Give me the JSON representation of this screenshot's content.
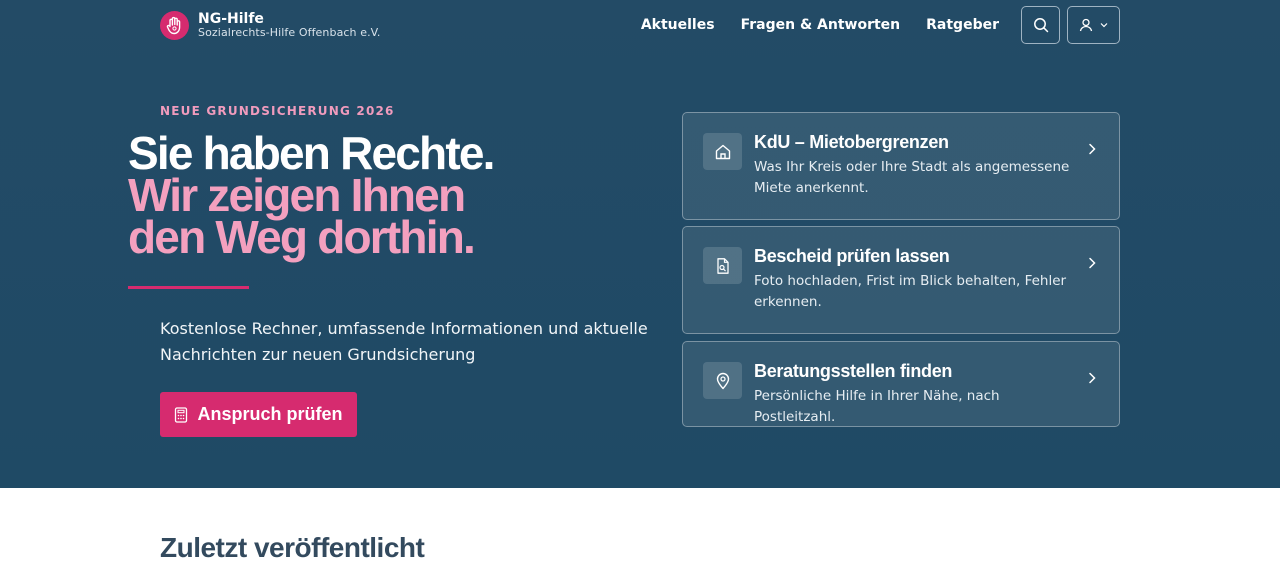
{
  "brand": {
    "title": "NG-Hilfe",
    "subtitle": "Sozialrechts-Hilfe Offenbach e.V.",
    "logo_icon": "hand-icon",
    "accent": "#d62b6f"
  },
  "nav": {
    "items": [
      {
        "label": "Aktuelles"
      },
      {
        "label": "Fragen & Antworten"
      },
      {
        "label": "Ratgeber"
      }
    ],
    "search_icon": "search-icon",
    "user_icon": "user-icon"
  },
  "hero": {
    "eyebrow": "NEUE GRUNDSICHERUNG 2026",
    "headline_line1": "Sie haben Rechte.",
    "headline_line2": "Wir zeigen Ihnen",
    "headline_line3": "den Weg dorthin.",
    "lead": "Kostenlose Rechner, umfassende Informationen und aktuelle Nachrichten zur neuen Grundsicherung",
    "cta_label": "Anspruch prüfen",
    "cta_icon": "calculator-icon",
    "background": "#234b66"
  },
  "cards": [
    {
      "title": "KdU – Mietobergrenzen",
      "description": "Was Ihr Kreis oder Ihre Stadt als angemessene Miete anerkennt.",
      "icon": "home-icon"
    },
    {
      "title": "Bescheid prüfen lassen",
      "description": "Foto hochladen, Frist im Blick behalten, Fehler erkennen.",
      "icon": "document-search-icon"
    },
    {
      "title": "Beratungsstellen finden",
      "description": "Persönliche Hilfe in Ihrer Nähe, nach Postleitzahl.",
      "icon": "map-pin-icon"
    }
  ],
  "recent": {
    "title": "Zuletzt veröffentlicht"
  }
}
